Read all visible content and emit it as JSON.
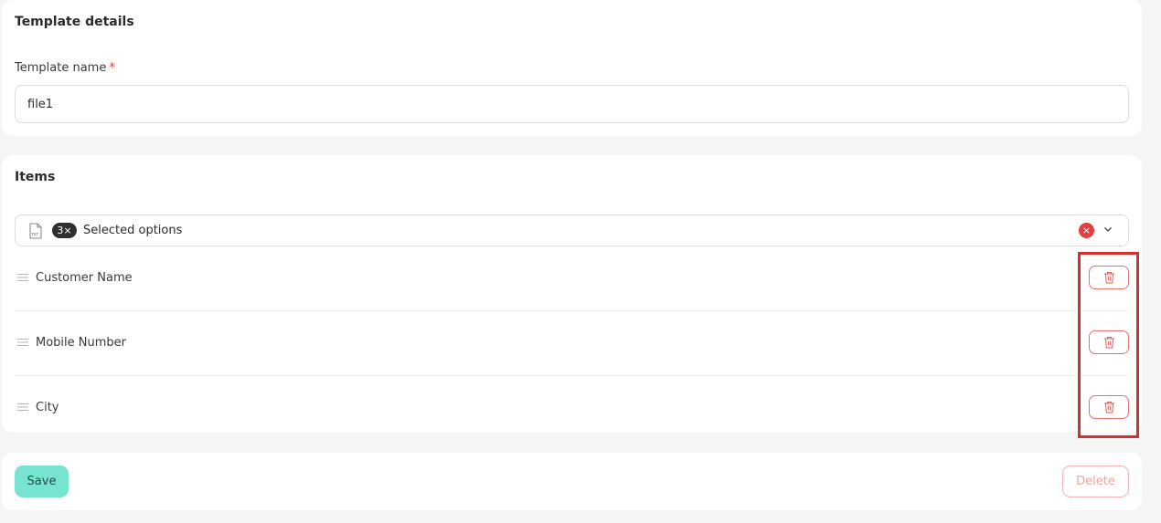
{
  "details": {
    "section_title": "Template details",
    "name_label": "Template name",
    "required_mark": "*",
    "name_value": "file1"
  },
  "items": {
    "section_title": "Items",
    "select": {
      "file_icon": "txt-file-icon",
      "count_badge": "3×",
      "text": "Selected options",
      "clear_icon": "clear-icon",
      "chevron_icon": "chevron-down-icon",
      "clear_symbol": "×"
    },
    "list": [
      {
        "label": "Customer Name"
      },
      {
        "label": "Mobile Number"
      },
      {
        "label": "City"
      }
    ]
  },
  "actions": {
    "save_label": "Save",
    "delete_label": "Delete"
  },
  "colors": {
    "accent": "#76e4cf",
    "danger": "#e53e3e",
    "highlight": "#d32f2f"
  }
}
